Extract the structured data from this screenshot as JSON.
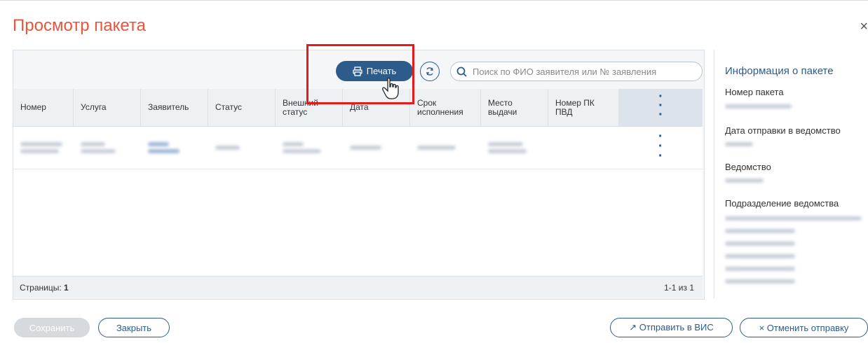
{
  "dialog": {
    "title": "Просмотр пакета",
    "close_symbol": "×"
  },
  "toolbar": {
    "print_label": "Печать",
    "print_icon": "printer-icon",
    "refresh_icon": "refresh-icon",
    "search_icon": "search-icon",
    "search_placeholder": "Поиск по ФИО заявителя или № заявления"
  },
  "table": {
    "columns": [
      "Номер",
      "Услуга",
      "Заявитель",
      "Статус",
      "Внешний статус",
      "Дата",
      "Срок исполнения",
      "Место выдачи",
      "Номер ПК ПВД"
    ],
    "row_menu_icon": "kebab-icon"
  },
  "footer": {
    "pages_label": "Страницы:",
    "pages_value": "1",
    "range": "1-1 из 1"
  },
  "info": {
    "title": "Информация о пакете",
    "package_number_label": "Номер пакета",
    "sent_date_label": "Дата отправки в ведомство",
    "agency_label": "Ведомство",
    "agency_division_label": "Подразделение ведомства"
  },
  "actions": {
    "save_label": "Сохранить",
    "close_label": "Закрыть",
    "send_vis_label": "↗ Отправить в ВИС",
    "cancel_send_label": "× Отменить отправку"
  },
  "colors": {
    "title": "#e8553c",
    "primary": "#2d5b8c",
    "highlight": "#e51b1b"
  }
}
